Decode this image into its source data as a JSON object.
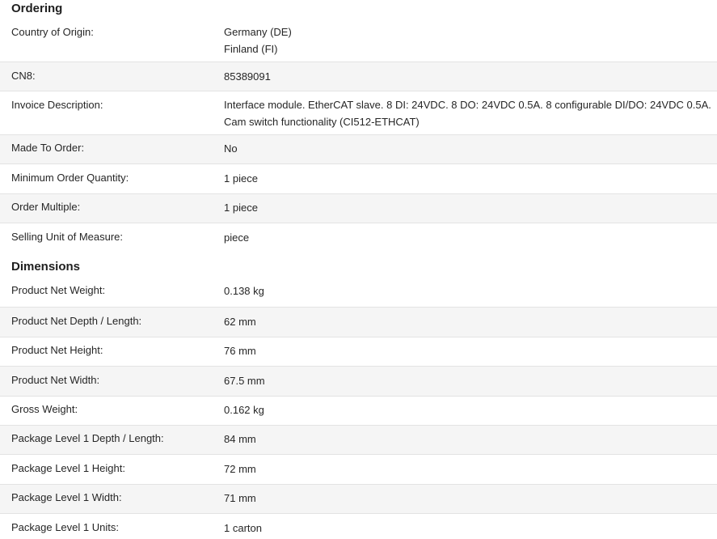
{
  "ordering": {
    "title": "Ordering",
    "rows": [
      {
        "label": "Country of Origin:",
        "values": [
          "Germany (DE)",
          "Finland (FI)"
        ]
      },
      {
        "label": "CN8:",
        "values": [
          "85389091"
        ]
      },
      {
        "label": "Invoice Description:",
        "values": [
          "Interface module. EtherCAT slave. 8 DI: 24VDC. 8 DO: 24VDC 0.5A. 8 configurable DI/DO: 24VDC 0.5A.",
          "Cam switch functionality (CI512-ETHCAT)"
        ]
      },
      {
        "label": "Made To Order:",
        "values": [
          "No"
        ]
      },
      {
        "label": "Minimum Order Quantity:",
        "values": [
          "1 piece"
        ]
      },
      {
        "label": "Order Multiple:",
        "values": [
          "1 piece"
        ]
      },
      {
        "label": "Selling Unit of Measure:",
        "values": [
          "piece"
        ]
      }
    ]
  },
  "dimensions": {
    "title": "Dimensions",
    "rows": [
      {
        "label": "Product Net Weight:",
        "values": [
          "0.138 kg"
        ]
      },
      {
        "label": "Product Net Depth / Length:",
        "values": [
          "62 mm"
        ]
      },
      {
        "label": "Product Net Height:",
        "values": [
          "76 mm"
        ]
      },
      {
        "label": "Product Net Width:",
        "values": [
          "67.5 mm"
        ]
      },
      {
        "label": "Gross Weight:",
        "values": [
          "0.162 kg"
        ]
      },
      {
        "label": "Package Level 1 Depth / Length:",
        "values": [
          "84 mm"
        ]
      },
      {
        "label": "Package Level 1 Height:",
        "values": [
          "72 mm"
        ]
      },
      {
        "label": "Package Level 1 Width:",
        "values": [
          "71 mm"
        ]
      },
      {
        "label": "Package Level 1 Units:",
        "values": [
          "1 carton"
        ]
      }
    ]
  }
}
